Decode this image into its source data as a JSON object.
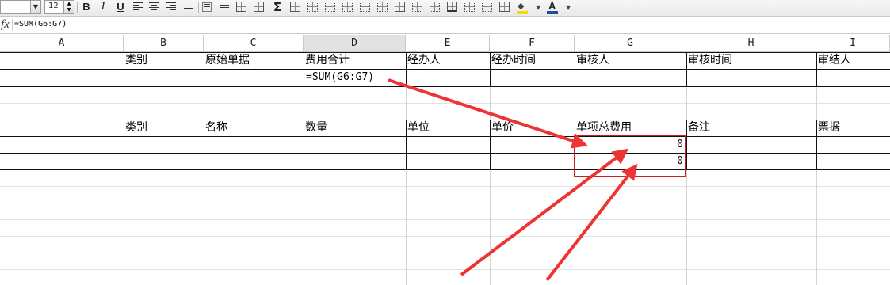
{
  "toolbar": {
    "font_size": "12",
    "bold_label": "B",
    "italic_label": "I",
    "underline_label": "U",
    "sum_label": "Σ",
    "font_color_label": "A",
    "font_color": "#1f4e9c",
    "fill_color": "#ffd800"
  },
  "formula_bar": {
    "fx_label": "fx",
    "value": "=SUM(G6:G7)"
  },
  "columns": [
    "A",
    "B",
    "C",
    "D",
    "E",
    "F",
    "G",
    "H",
    "I"
  ],
  "active_column": "D",
  "table1": {
    "headers": [
      "类别",
      "原始单据",
      "费用合计",
      "经办人",
      "经办时间",
      "审核人",
      "审核时间",
      "审结人"
    ],
    "formula_cell": "=SUM(G6:G7)"
  },
  "table2": {
    "headers": [
      "类别",
      "名称",
      "数量",
      "单位",
      "单价",
      "单项总费用",
      "备注",
      "票据"
    ],
    "totals": [
      "0",
      "0"
    ]
  },
  "annotation_color": "#ee3333"
}
